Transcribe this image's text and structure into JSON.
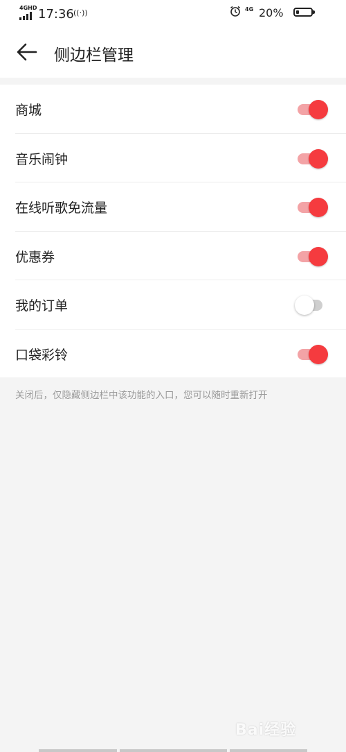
{
  "status_bar": {
    "network_left": "4GHD",
    "time": "17:36",
    "network_right": "4G",
    "battery_percent": "20%",
    "battery_level": 0.2
  },
  "header": {
    "back_icon": "arrow-left-icon",
    "title": "侧边栏管理"
  },
  "settings": [
    {
      "label": "商城",
      "enabled": true
    },
    {
      "label": "音乐闹钟",
      "enabled": true
    },
    {
      "label": "在线听歌免流量",
      "enabled": true
    },
    {
      "label": "优惠券",
      "enabled": true
    },
    {
      "label": "我的订单",
      "enabled": false
    },
    {
      "label": "口袋彩铃",
      "enabled": true
    }
  ],
  "footnote": "关闭后，仅隐藏侧边栏中该功能的入口，您可以随时重新打开",
  "watermark": "Bai经验",
  "colors": {
    "accent": "#f53b3f",
    "track_on": "#f3a3a6",
    "track_off": "#cfcfcf",
    "background": "#f4f4f4"
  }
}
